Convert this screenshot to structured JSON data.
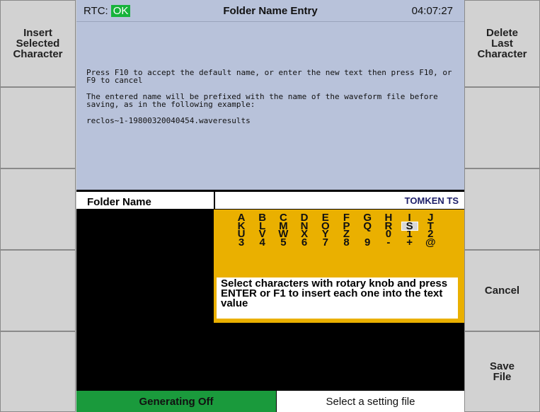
{
  "softkeys": {
    "left": [
      {
        "label": "Insert\nSelected\nCharacter"
      },
      {
        "label": ""
      },
      {
        "label": ""
      },
      {
        "label": ""
      },
      {
        "label": ""
      }
    ],
    "right": [
      {
        "label": "Delete\nLast\nCharacter"
      },
      {
        "label": ""
      },
      {
        "label": ""
      },
      {
        "label": "Cancel"
      },
      {
        "label": "Save\nFile"
      }
    ]
  },
  "titlebar": {
    "rtc_label": "RTC:",
    "rtc_status": "OK",
    "title": "Folder Name Entry",
    "clock": "04:07:27"
  },
  "info": {
    "line1": "Press F10 to accept the default name, or enter the new text then press F10, or F9 to cancel",
    "line2": "The entered name will be prefixed with the name of the waveform file before saving, as in the following example:",
    "line3": "reclos~1-19800320040454.waveresults"
  },
  "folder_name": {
    "label": "Folder Name",
    "value": "TOMKEN TS"
  },
  "keyboard": {
    "columns": [
      [
        "A",
        "K",
        "U",
        "3"
      ],
      [
        "B",
        "L",
        "V",
        "4"
      ],
      [
        "C",
        "M",
        "W",
        "5"
      ],
      [
        "D",
        "N",
        "X",
        "6"
      ],
      [
        "E",
        "O",
        "Y",
        "7"
      ],
      [
        "F",
        "P",
        "Z",
        "8"
      ],
      [
        "G",
        "Q",
        "",
        "9"
      ],
      [
        "H",
        "R",
        "0",
        "-"
      ],
      [
        "I",
        "S",
        "1",
        "+"
      ],
      [
        "J",
        "T",
        "2",
        "@"
      ]
    ],
    "selected": "S",
    "instructions": "Select characters with rotary knob and press ENTER or F1 to insert each one into the text value"
  },
  "status": {
    "generating": "Generating Off",
    "setting": "Select a setting file"
  },
  "colors": {
    "accent_green": "#1a9a3c",
    "keyboard_yellow": "#eab000",
    "info_blue": "#b8c2da",
    "name_text": "#1d1f6a"
  }
}
